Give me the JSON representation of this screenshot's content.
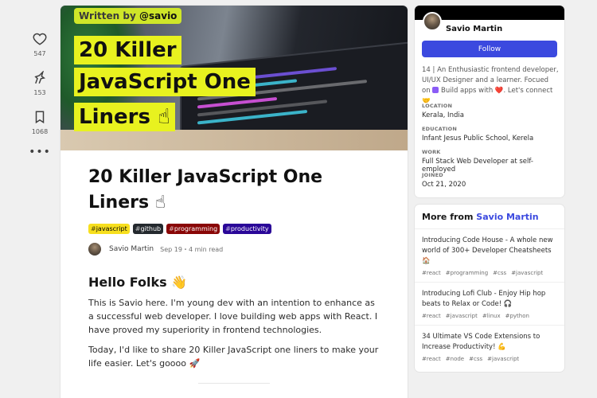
{
  "reactions": [
    {
      "icon": "heart-icon",
      "count": "547"
    },
    {
      "icon": "unicorn-icon",
      "count": "153"
    },
    {
      "icon": "bookmark-icon",
      "count": "1068"
    }
  ],
  "more_label": "•••",
  "cover": {
    "written_by": "Written by",
    "handle": "@savio",
    "lines": [
      "20 Killer",
      "JavaScript One",
      "Liners ☝"
    ]
  },
  "article": {
    "title": "20 Killer JavaScript One Liners ☝",
    "tags": [
      {
        "hash": "#",
        "name": "javascript",
        "bg": "#f7df1e",
        "fg": "#000000"
      },
      {
        "hash": "#",
        "name": "github",
        "bg": "#24292e",
        "fg": "#ffffff"
      },
      {
        "hash": "#",
        "name": "programming",
        "bg": "#890606",
        "fg": "#ffffff"
      },
      {
        "hash": "#",
        "name": "productivity",
        "bg": "#2a0798",
        "fg": "#ffffff"
      }
    ],
    "author": "Savio Martin",
    "date": "Sep 19",
    "read_time": "・4 min read",
    "heading": "Hello Folks 👋",
    "paragraphs": [
      "This is Savio here. I'm young dev with an intention to enhance as a successful web developer. I love building web apps with React. I have proved my superiority in frontend technologies.",
      "Today, I'd like to share 20 Killer JavaScript one liners to make your life easier. Let's goooo 🚀"
    ]
  },
  "profile": {
    "name": "Savio Martin",
    "follow_label": "Follow",
    "bio": "14 | An Enthusiastic frontend developer, UI/UX Designer and a learner. Focued on",
    "bio_tail": "Build apps with ❤️. Let's connect 🤝",
    "fields": [
      {
        "key": "LOCATION",
        "value": "Kerala, India"
      },
      {
        "key": "EDUCATION",
        "value": "Infant Jesus Public School, Kerela"
      },
      {
        "key": "WORK",
        "value": "Full Stack Web Developer at self-employed"
      },
      {
        "key": "JOINED",
        "value": "Oct 21, 2020"
      }
    ]
  },
  "more_from": {
    "label": "More from",
    "author": "Savio Martin",
    "items": [
      {
        "title": "Introducing Code House - A whole new world of 300+ Developer Cheatsheets 🏠",
        "tags": [
          "#react",
          "#programming",
          "#css",
          "#javascript"
        ]
      },
      {
        "title": "Introducing Lofi Club - Enjoy Hip hop beats to Relax or Code! 🎧",
        "tags": [
          "#react",
          "#javascript",
          "#linux",
          "#python"
        ]
      },
      {
        "title": "34 Ultimate VS Code Extensions to Increase Productivity! 💪",
        "tags": [
          "#react",
          "#node",
          "#css",
          "#javascript"
        ]
      }
    ]
  },
  "colors": {
    "accent": "#3b49df",
    "cover_highlight": "#e8f21f"
  }
}
